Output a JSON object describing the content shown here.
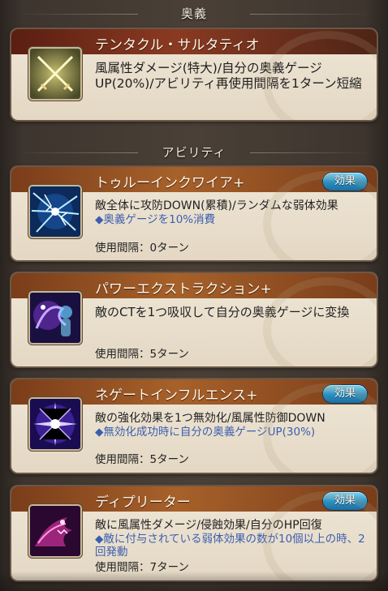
{
  "sections": {
    "ougi_title": "奥義",
    "ability_title": "アビリティ"
  },
  "ougi": {
    "name": "テンタクル・サルタティオ",
    "description": "風属性ダメージ(特大)/自分の奥義ゲージUP(20%)/アビリティ再使用間隔を1ターン短縮",
    "icon": "crossed-swords-icon"
  },
  "abilities": [
    {
      "name": "トゥルーインクワイア+",
      "effect_button": "効果",
      "description": "敵全体に攻防DOWN(累積)/ランダムな弱体効果",
      "sub_note": "◆奥義ゲージを10%消費",
      "cooldown": "使用間隔：0ターン",
      "icon": "lightning-web-icon"
    },
    {
      "name": "パワーエクストラクション+",
      "effect_button": "",
      "description": "敵のCTを1つ吸収して自分の奥義ゲージに変換",
      "sub_note": "",
      "cooldown": "使用間隔：5ターン",
      "icon": "energy-absorb-icon"
    },
    {
      "name": "ネゲートインフルエンス+",
      "effect_button": "効果",
      "description": "敵の強化効果を1つ無効化/風属性防御DOWN",
      "sub_note": "◆無効化成功時に自分の奥義ゲージUP(30%)",
      "cooldown": "使用間隔：5ターン",
      "icon": "starburst-icon"
    },
    {
      "name": "ディプリーター",
      "effect_button": "効果",
      "description": "敵に風属性ダメージ/侵蝕効果/自分のHP回復",
      "sub_note": "◆敵に付与されている弱体効果の数が10個以上の時、2回発動",
      "cooldown": "使用間隔：7ターン",
      "icon": "tentacle-beast-icon"
    }
  ]
}
